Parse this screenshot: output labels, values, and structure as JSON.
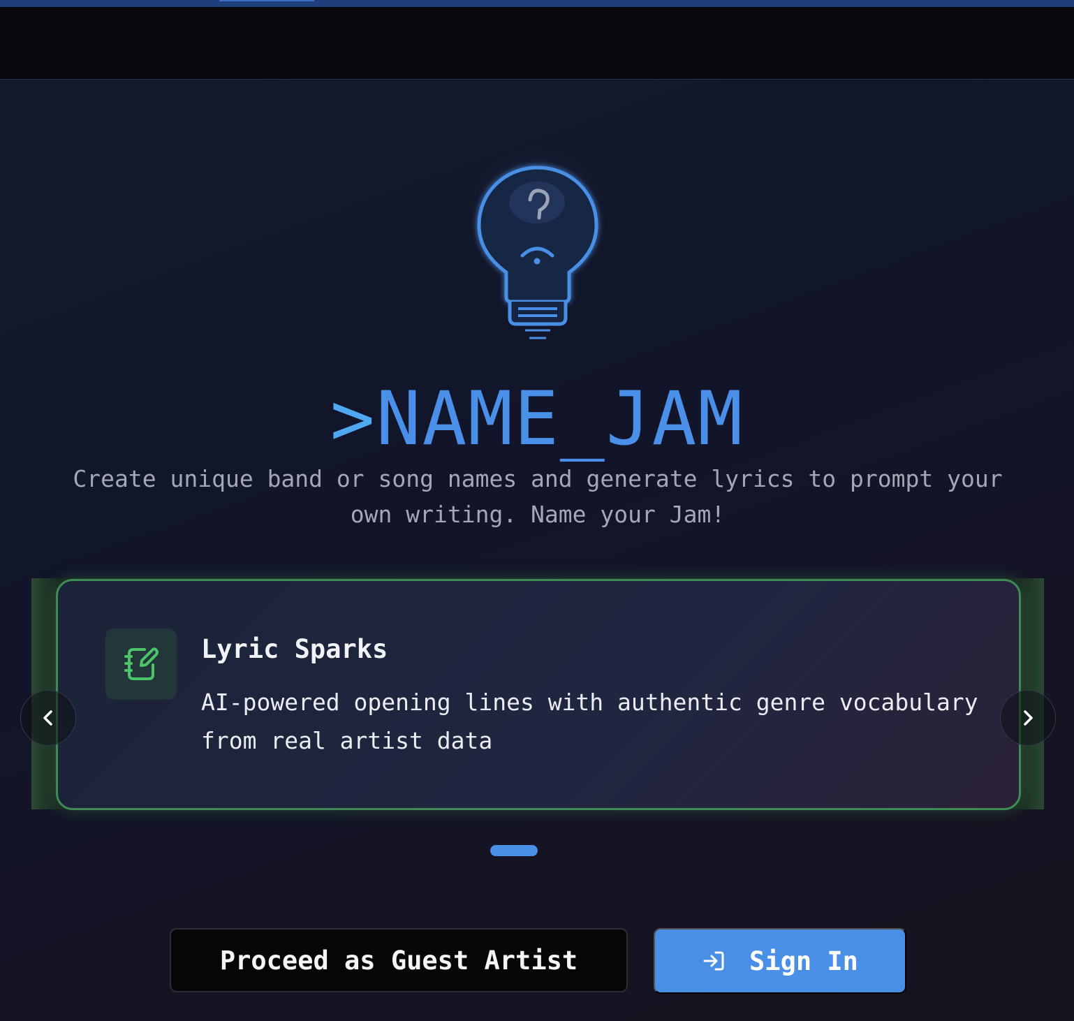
{
  "app": {
    "title_prefix": ">",
    "title": "NAME_JAM",
    "subtitle": "Create unique band or song names and generate lyrics to prompt your own writing. Name your Jam!"
  },
  "icons": {
    "logo": "lightbulb-question-icon",
    "card": "notebook-pen-icon",
    "prev": "chevron-left-icon",
    "next": "chevron-right-icon",
    "signin": "sign-in-icon"
  },
  "carousel": {
    "active_index": 0,
    "slides": [
      {
        "title": "Lyric Sparks",
        "description": "AI-powered opening lines with authentic genre vocabulary from real artist data"
      }
    ]
  },
  "actions": {
    "guest_label": "Proceed as Guest Artist",
    "signin_label": "Sign In"
  },
  "colors": {
    "accent": "#4a8fe6",
    "card_border": "#3f8a55",
    "card_icon": "#4cc46a"
  }
}
